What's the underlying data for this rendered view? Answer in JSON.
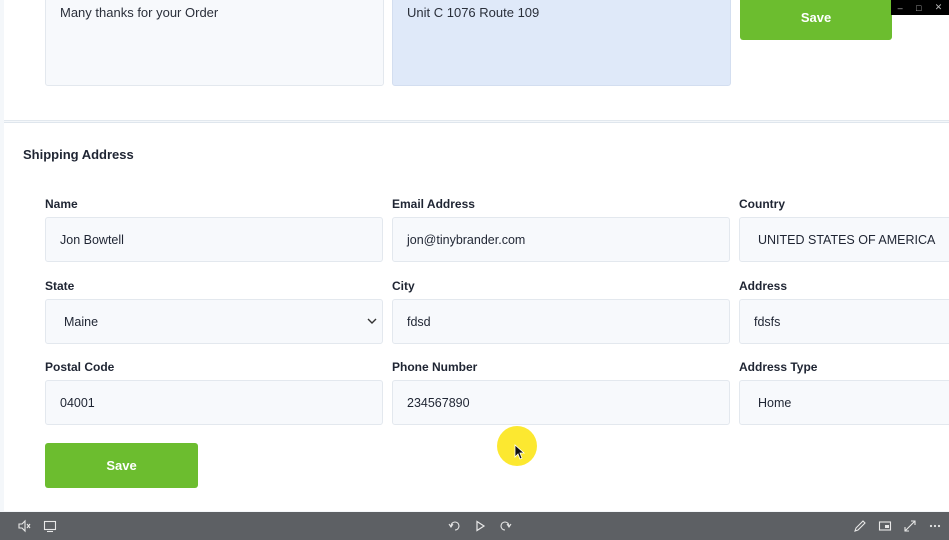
{
  "top_section": {
    "message_text": "Many thanks for your Order",
    "address_text": "Unit C  1076 Route 109",
    "save_label": "Save"
  },
  "shipping": {
    "title": "Shipping Address",
    "fields": {
      "name": {
        "label": "Name",
        "value": "Jon Bowtell"
      },
      "email": {
        "label": "Email Address",
        "value": "jon@tinybrander.com"
      },
      "country": {
        "label": "Country",
        "value": "UNITED STATES OF AMERICA"
      },
      "state": {
        "label": "State",
        "value": "Maine"
      },
      "city": {
        "label": "City",
        "value": "fdsd"
      },
      "address": {
        "label": "Address",
        "value": "fdsfs"
      },
      "postal_code": {
        "label": "Postal Code",
        "value": "04001"
      },
      "phone": {
        "label": "Phone Number",
        "value": "234567890"
      },
      "address_type": {
        "label": "Address Type",
        "value": "Home"
      }
    },
    "save_label": "Save"
  },
  "colors": {
    "accent": "#6cbd2f",
    "field_bg": "#f7f9fc",
    "highlight_field_bg": "#dfe9f9",
    "cursor_highlight": "#fce61e",
    "taskbar": "#5d6064"
  },
  "icons": {
    "window_controls": [
      "minimize-icon",
      "restore-icon",
      "close-icon"
    ],
    "select_chevron": "chevron-down-icon",
    "cursor": "mouse-pointer-icon",
    "taskbar_left": [
      "mute-icon",
      "subtitles-icon"
    ],
    "taskbar_center": [
      "rewind-icon",
      "play-icon",
      "forward-icon"
    ],
    "taskbar_right": [
      "pen-icon",
      "screen-icon",
      "fullscreen-icon",
      "more-icon"
    ]
  }
}
